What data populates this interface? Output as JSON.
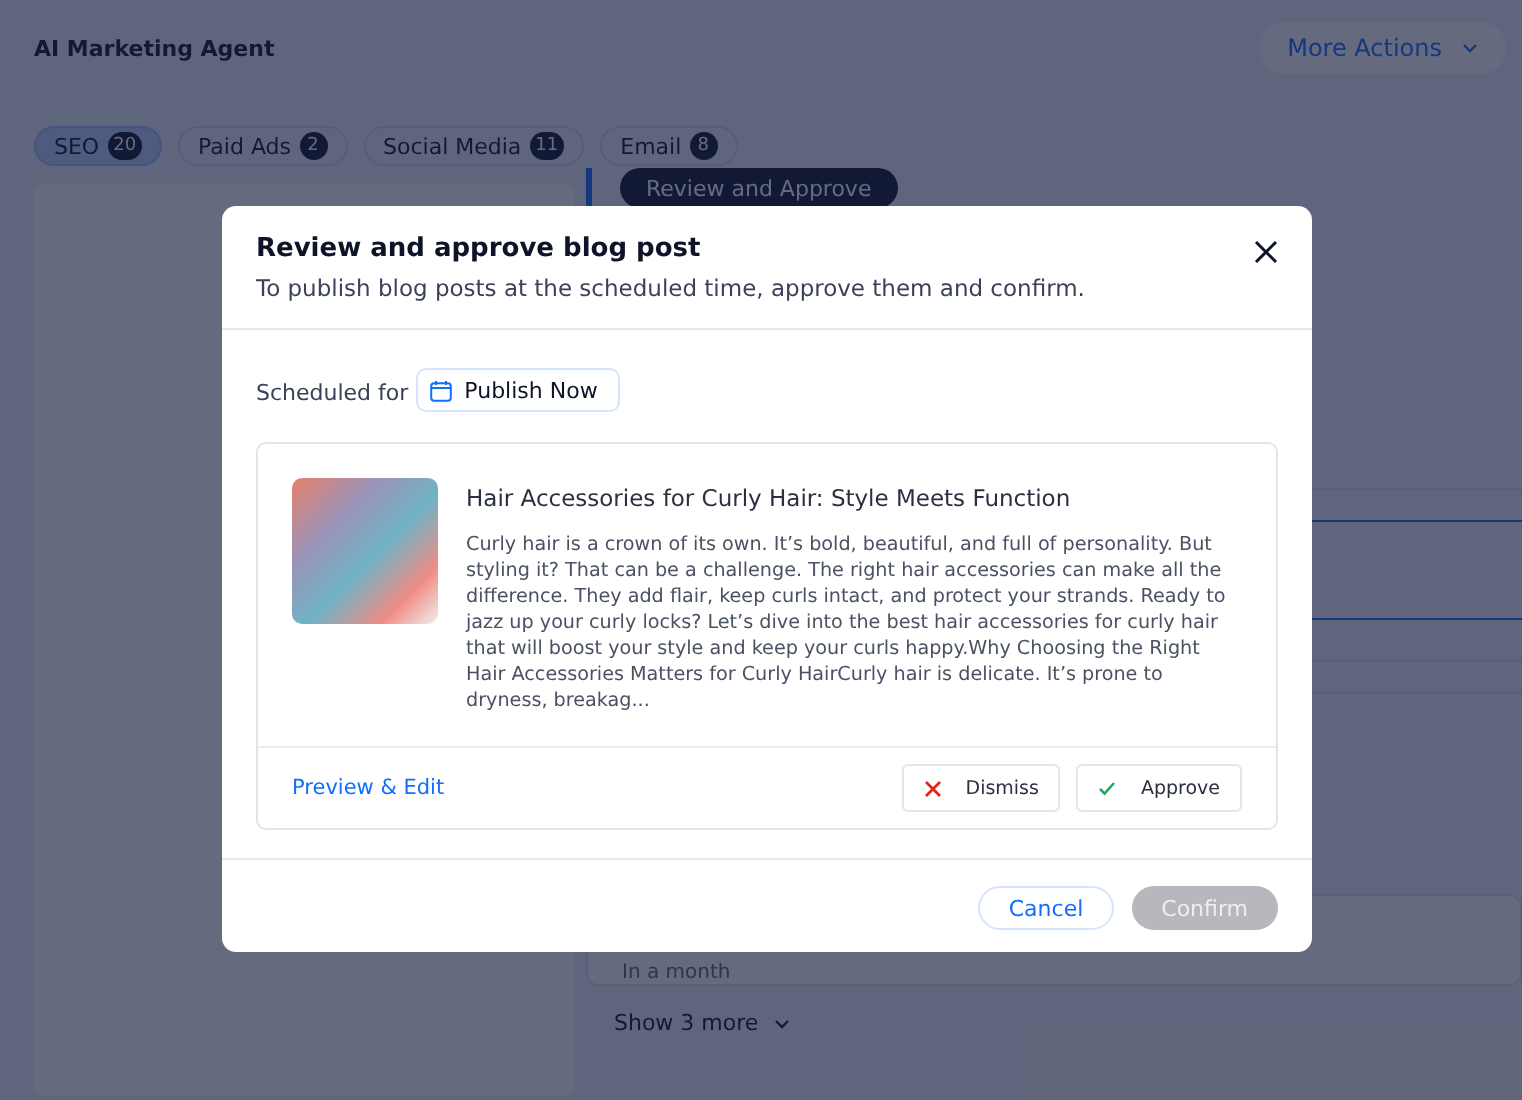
{
  "header": {
    "title": "AI Marketing Agent",
    "more_actions": "More Actions"
  },
  "tabs": [
    {
      "label": "SEO",
      "count": "20",
      "selected": true
    },
    {
      "label": "Paid Ads",
      "count": "2",
      "selected": false
    },
    {
      "label": "Social Media",
      "count": "11",
      "selected": false
    },
    {
      "label": "Email",
      "count": "8",
      "selected": false
    }
  ],
  "background": {
    "review_button": "Review and Approve",
    "item_time": "In a month",
    "show_more": "Show 3 more"
  },
  "modal": {
    "title": "Review and approve blog post",
    "subtitle": "To publish blog posts at the scheduled time, approve them and confirm.",
    "scheduled_label": "Scheduled for",
    "schedule_value": "Publish Now",
    "post": {
      "title": "Hair Accessories for Curly Hair: Style Meets Function",
      "excerpt": "Curly hair is a crown of its own. It’s bold, beautiful, and full of personality. But styling it? That can be a challenge. The right hair accessories can make all the difference. They add flair, keep curls intact, and protect your strands. Ready to jazz up your curly locks? Let’s dive into the best hair accessories for curly hair that will boost your style and keep your curls happy.Why Choosing the Right Hair Accessories Matters for Curly HairCurly hair is delicate. It’s prone to dryness, breakag...",
      "preview_link": "Preview & Edit",
      "dismiss": "Dismiss",
      "approve": "Approve"
    },
    "cancel": "Cancel",
    "confirm": {
      "label": "Confirm",
      "disabled": true
    }
  }
}
